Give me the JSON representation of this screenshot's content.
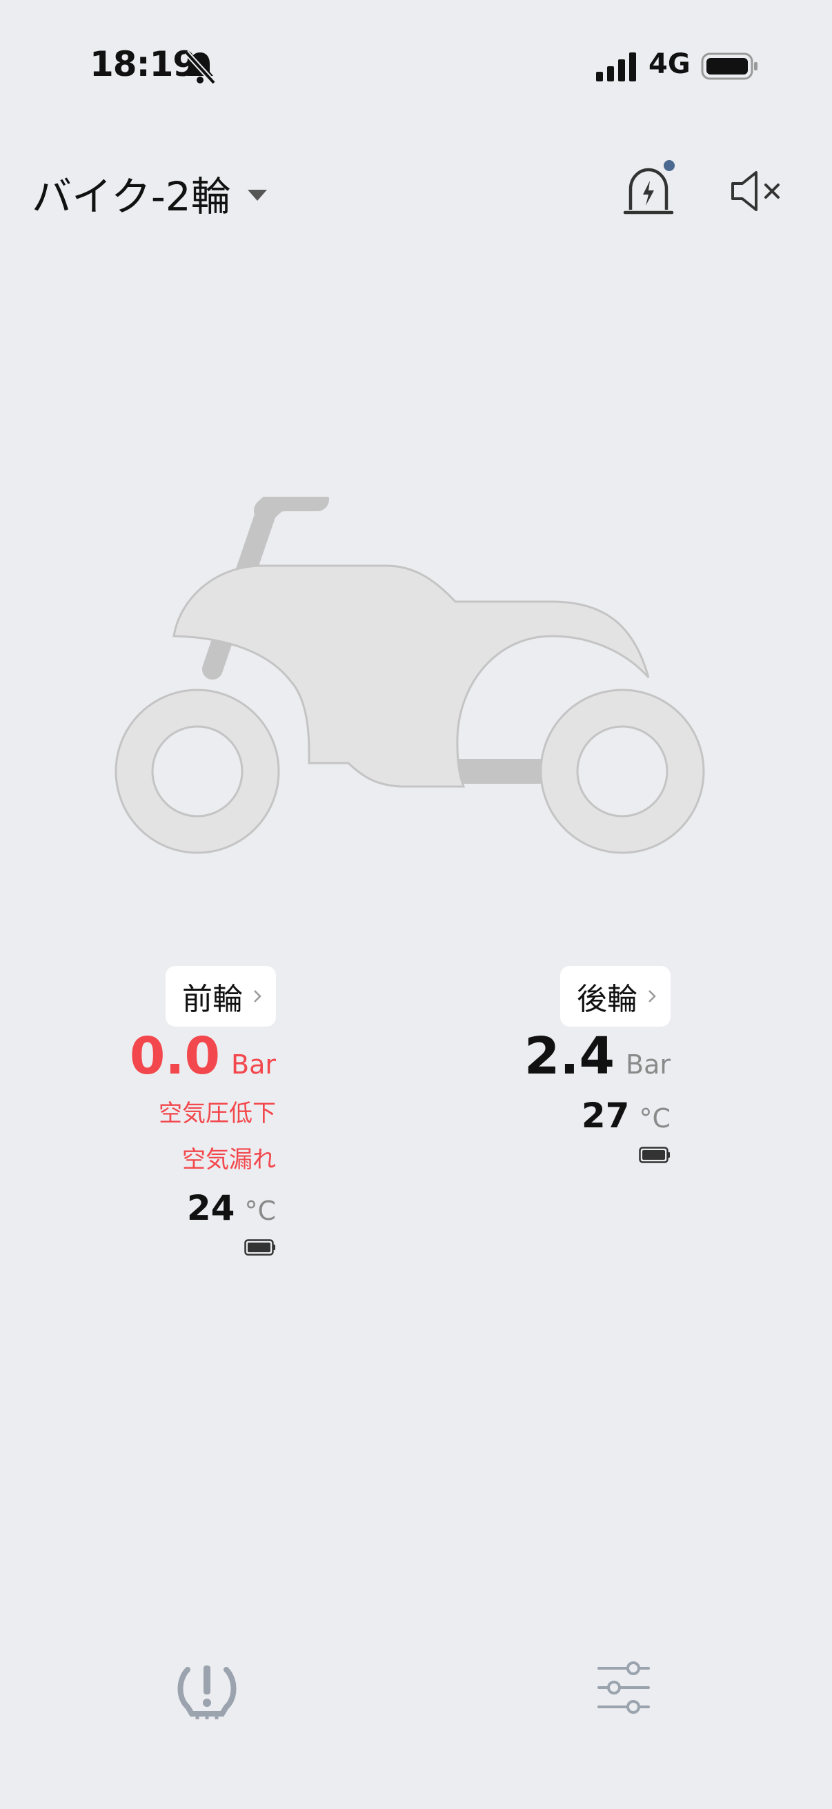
{
  "status_bar": {
    "time": "18:19",
    "network": "4G"
  },
  "header": {
    "title": "バイク-2輪"
  },
  "tires": {
    "front": {
      "label": "前輪",
      "pressure": "0.0",
      "unit": "Bar",
      "warnings": [
        "空気圧低下",
        "空気漏れ"
      ],
      "temp": "24",
      "temp_unit": "°C"
    },
    "rear": {
      "label": "後輪",
      "pressure": "2.4",
      "unit": "Bar",
      "temp": "27",
      "temp_unit": "°C"
    }
  },
  "icons": {
    "alarm": "alarm-light-icon",
    "mute": "speaker-mute-icon",
    "tpms": "tpms-warning-icon",
    "settings": "sliders-icon"
  },
  "colors": {
    "alert": "#F2474C",
    "background": "#ECEDF0",
    "notification_dot": "#4A6890"
  }
}
